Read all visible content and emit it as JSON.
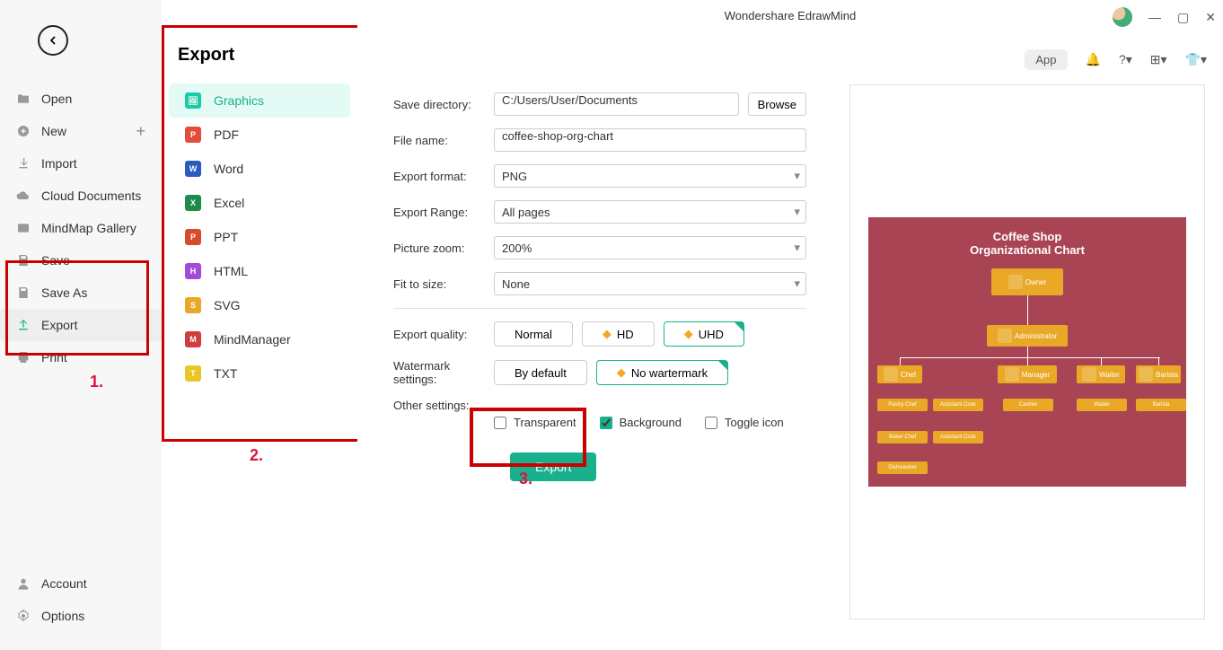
{
  "app_title": "Wondershare EdrawMind",
  "header": {
    "app": "App"
  },
  "sidebar": {
    "items": [
      {
        "label": "Open"
      },
      {
        "label": "New"
      },
      {
        "label": "Import"
      },
      {
        "label": "Cloud Documents"
      },
      {
        "label": "MindMap Gallery"
      },
      {
        "label": "Save"
      },
      {
        "label": "Save As"
      },
      {
        "label": "Export"
      },
      {
        "label": "Print"
      }
    ],
    "bottom": [
      {
        "label": "Account"
      },
      {
        "label": "Options"
      }
    ]
  },
  "annotations": {
    "a1": "1.",
    "a2": "2.",
    "a3": "3."
  },
  "export_panel": {
    "title": "Export",
    "items": [
      {
        "label": "Graphics"
      },
      {
        "label": "PDF"
      },
      {
        "label": "Word"
      },
      {
        "label": "Excel"
      },
      {
        "label": "PPT"
      },
      {
        "label": "HTML"
      },
      {
        "label": "SVG"
      },
      {
        "label": "MindManager"
      },
      {
        "label": "TXT"
      }
    ]
  },
  "form": {
    "save_dir_label": "Save directory:",
    "save_dir_value": "C:/Users/User/Documents",
    "browse": "Browse",
    "file_name_label": "File name:",
    "file_name_value": "coffee-shop-org-chart",
    "format_label": "Export format:",
    "format_value": "PNG",
    "range_label": "Export Range:",
    "range_value": "All pages",
    "zoom_label": "Picture zoom:",
    "zoom_value": "200%",
    "fit_label": "Fit to size:",
    "fit_value": "None",
    "quality_label": "Export quality:",
    "quality_normal": "Normal",
    "quality_hd": "HD",
    "quality_uhd": "UHD",
    "watermark_label": "Watermark settings:",
    "watermark_default": "By default",
    "watermark_none": "No wartermark",
    "other_label": "Other settings:",
    "chk_transparent": "Transparent",
    "chk_background": "Background",
    "chk_toggle": "Toggle icon",
    "export_btn": "Export"
  },
  "preview": {
    "title": "Coffee Shop",
    "subtitle": "Organizational Chart",
    "owner": "Owner",
    "admin": "Administrator",
    "chef": "Chef",
    "manager": "Manager",
    "waiter": "Waiter",
    "barista": "Barista",
    "pastry_chef": "Pastry Chef",
    "asst_cook": "Assistant Cook",
    "cashier": "Cashier",
    "waiter2": "Waiter",
    "barista2": "Barista",
    "baker_chef": "Baker Chef",
    "asst_cook2": "Assistant Cook",
    "dishwasher": "Dishwasher"
  }
}
